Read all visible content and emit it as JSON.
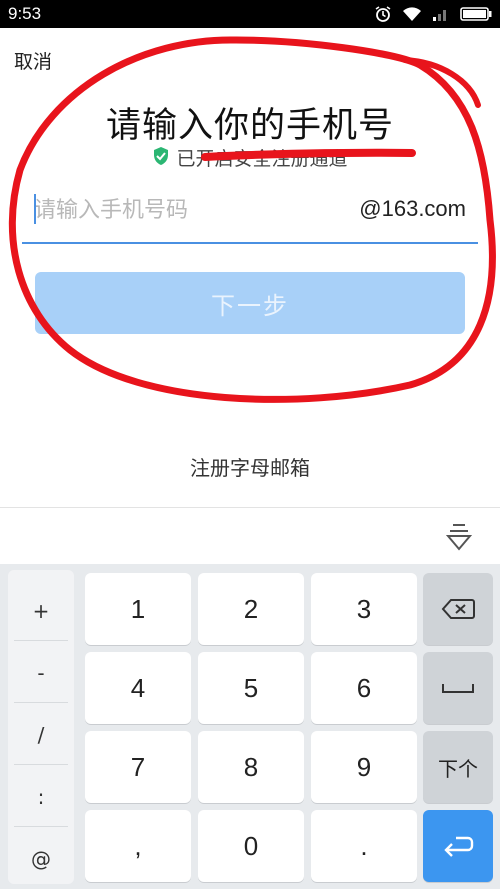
{
  "status_bar": {
    "time": "9:53"
  },
  "header": {
    "cancel_label": "取消"
  },
  "title": "请输入你的手机号",
  "secure_text": "已开启安全注册通道",
  "phone": {
    "placeholder": "请输入手机号码",
    "value": "",
    "domain": "@163.com"
  },
  "next_label": "下一步",
  "letter_mailbox_link": "注册字母邮箱",
  "keyboard": {
    "symbols": [
      "+",
      "-",
      "/",
      ":",
      "@"
    ],
    "digits": [
      "1",
      "2",
      "3",
      "4",
      "5",
      "6",
      "7",
      "8",
      "9",
      "0"
    ],
    "comma": ",",
    "dot": ".",
    "next_key_label": "下个"
  },
  "colors": {
    "accent": "#4a90e2",
    "button_disabled": "#a8d0f8",
    "annotation": "#e8141c",
    "secure_shield": "#2bb673",
    "enter_key": "#3c96f0"
  }
}
